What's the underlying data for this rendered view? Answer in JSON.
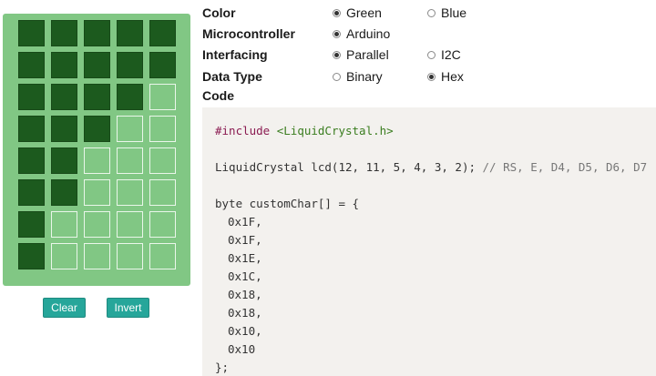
{
  "grid": {
    "rows": [
      [
        1,
        1,
        1,
        1,
        1
      ],
      [
        1,
        1,
        1,
        1,
        1
      ],
      [
        1,
        1,
        1,
        1,
        0
      ],
      [
        1,
        1,
        1,
        0,
        0
      ],
      [
        1,
        1,
        0,
        0,
        0
      ],
      [
        1,
        1,
        0,
        0,
        0
      ],
      [
        1,
        0,
        0,
        0,
        0
      ],
      [
        1,
        0,
        0,
        0,
        0
      ]
    ],
    "on_color": "#1c5a1e",
    "off_color": "#81c784"
  },
  "buttons": {
    "clear_label": "Clear",
    "invert_label": "Invert",
    "color": "#26a69a"
  },
  "options": {
    "color": {
      "label": "Color",
      "choices": [
        "Green",
        "Blue"
      ],
      "selected": "Green"
    },
    "micro": {
      "label": "Microcontroller",
      "choices": [
        "Arduino"
      ],
      "selected": "Arduino"
    },
    "iface": {
      "label": "Interfacing",
      "choices": [
        "Parallel",
        "I2C"
      ],
      "selected": "Parallel"
    },
    "dtype": {
      "label": "Data Type",
      "choices": [
        "Binary",
        "Hex"
      ],
      "selected": "Hex"
    }
  },
  "code": {
    "label": "Code",
    "include_kw": "#include",
    "include_file": "<LiquidCrystal.h>",
    "lcd_decl_prefix": "LiquidCrystal lcd(",
    "lcd_args": "12, 11, 5, 4, 3, 2",
    "lcd_decl_suffix": ");",
    "lcd_comment": "// RS, E, D4, D5, D6, D7",
    "array_decl": "byte customChar[] = {",
    "hex_values": [
      "0x1F,",
      "0x1F,",
      "0x1E,",
      "0x1C,",
      "0x18,",
      "0x18,",
      "0x10,",
      "0x10"
    ],
    "array_close": "};"
  }
}
